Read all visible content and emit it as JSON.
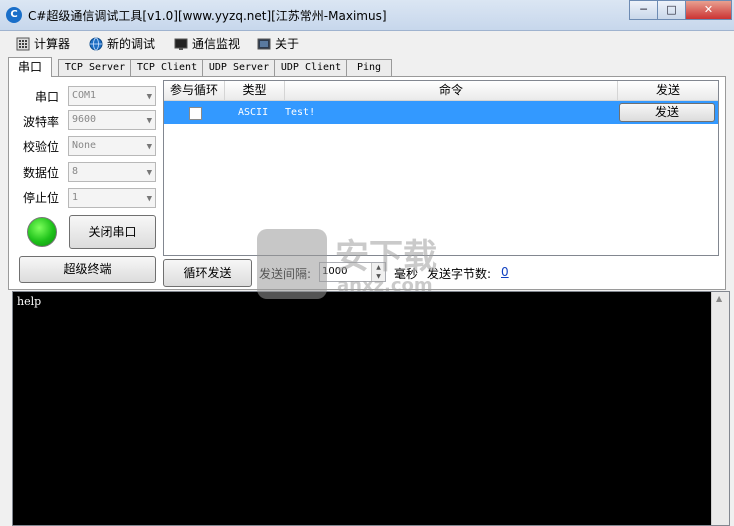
{
  "window": {
    "title": "C#超级通信调试工具[v1.0][www.yyzq.net][江苏常州-Maximus]",
    "controls": {
      "minimize": "─",
      "maximize": "□",
      "close": "✕"
    }
  },
  "menu": {
    "items": [
      {
        "label": "计算器",
        "icon": "calculator-icon"
      },
      {
        "label": "新的调试",
        "icon": "globe-icon"
      },
      {
        "label": "通信监视",
        "icon": "monitor-icon"
      },
      {
        "label": "关于",
        "icon": "info-icon"
      }
    ]
  },
  "tabs": [
    "串口",
    "TCP Server",
    "TCP Client",
    "UDP Server",
    "UDP Client",
    "Ping"
  ],
  "serial": {
    "port_label": "串口",
    "port_value": "COM1",
    "baud_label": "波特率",
    "baud_value": "9600",
    "parity_label": "校验位",
    "parity_value": "None",
    "databits_label": "数据位",
    "databits_value": "8",
    "stopbits_label": "停止位",
    "stopbits_value": "1",
    "close_port_button": "关闭串口",
    "super_terminal_button": "超级终端",
    "status_color": "#1ec21a"
  },
  "command_table": {
    "headers": [
      "参与循环",
      "类型",
      "命令",
      "发送"
    ],
    "rows": [
      {
        "loop": false,
        "type": "ASCII",
        "command": "Test!",
        "send": "发送"
      }
    ],
    "selection_color": "#3399ff"
  },
  "loop_send": {
    "button": "循环发送",
    "interval_label": "发送间隔:",
    "interval_value": "1000",
    "unit": "毫秒",
    "bytes_label": "发送字节数:",
    "bytes_value": "0"
  },
  "console": {
    "text": "help"
  },
  "watermark": {
    "text": "安下载",
    "sub": "anxz.com"
  }
}
